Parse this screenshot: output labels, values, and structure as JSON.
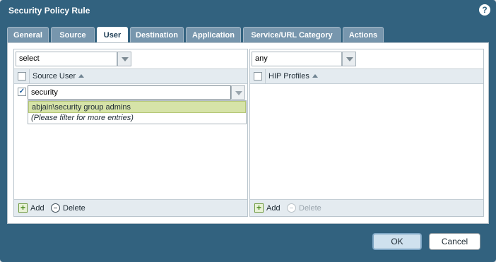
{
  "dialog": {
    "title": "Security Policy Rule",
    "help": "?"
  },
  "tabs": [
    {
      "label": "General"
    },
    {
      "label": "Source"
    },
    {
      "label": "User",
      "active": true
    },
    {
      "label": "Destination"
    },
    {
      "label": "Application"
    },
    {
      "label": "Service/URL Category"
    },
    {
      "label": "Actions"
    }
  ],
  "left_panel": {
    "selector_value": "select",
    "column_header": "Source User",
    "edit_row": {
      "checked": true,
      "check_glyph": "✓",
      "value": "security"
    },
    "suggestions": {
      "item": "abjain\\security group admins",
      "hint": "(Please filter for more entries)"
    },
    "footer": {
      "add_label": "Add",
      "delete_label": "Delete"
    }
  },
  "right_panel": {
    "selector_value": "any",
    "column_header": "HIP Profiles",
    "footer": {
      "add_label": "Add",
      "delete_label": "Delete",
      "delete_disabled": true
    }
  },
  "buttons": {
    "ok": "OK",
    "cancel": "Cancel"
  },
  "icons": {
    "add": "plus-icon",
    "delete": "minus-circle-icon",
    "sort": "sort-asc-icon",
    "dropdown": "chevron-down-icon"
  },
  "colors": {
    "dialog_bg": "#32627f",
    "tab_inactive": "#7796ad",
    "suggestion_highlight": "#d6e3a8"
  }
}
